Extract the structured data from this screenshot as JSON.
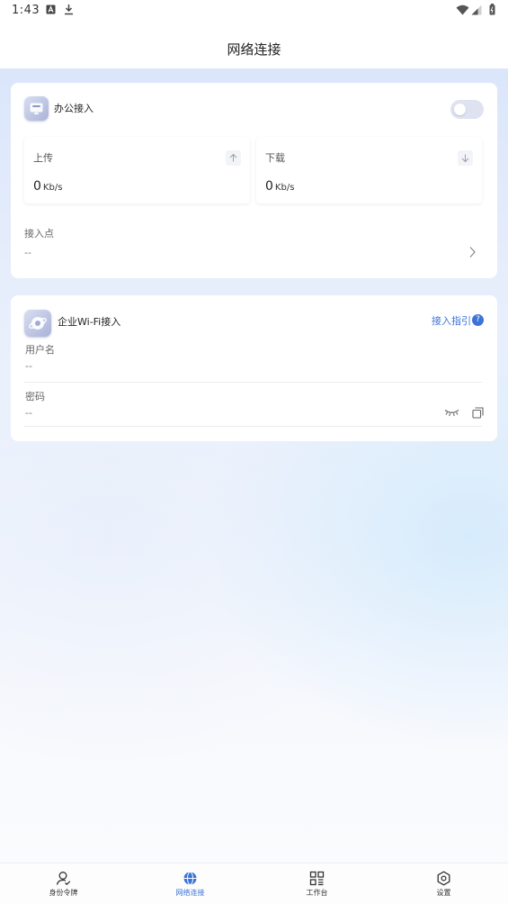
{
  "status_bar": {
    "time": "1:43",
    "left_icons": [
      "a-box-icon",
      "download-icon"
    ],
    "right_icons": [
      "wifi-icon",
      "signal-icon",
      "battery-icon"
    ]
  },
  "header": {
    "title": "网络连接"
  },
  "office_card": {
    "title": "办公接入",
    "toggle_on": false,
    "upload": {
      "label": "上传",
      "value": "0",
      "unit": "Kb/s"
    },
    "download": {
      "label": "下载",
      "value": "0",
      "unit": "Kb/s"
    },
    "access_point": {
      "label": "接入点",
      "value": "--"
    }
  },
  "wifi_card": {
    "title": "企业Wi-Fi接入",
    "guide_label": "接入指引",
    "guide_badge": "?",
    "username": {
      "label": "用户名",
      "value": "--"
    },
    "password": {
      "label": "密码",
      "value": "--"
    }
  },
  "tabbar": {
    "items": [
      {
        "label": "身份令牌",
        "icon": "person-icon",
        "active": false
      },
      {
        "label": "网络连接",
        "icon": "globe-icon",
        "active": true
      },
      {
        "label": "工作台",
        "icon": "grid-icon",
        "active": false
      },
      {
        "label": "设置",
        "icon": "gear-icon",
        "active": false
      }
    ]
  },
  "colors": {
    "accent": "#3d73d6",
    "card": "#ffffff",
    "toggle_off": "#dfe2f0"
  }
}
